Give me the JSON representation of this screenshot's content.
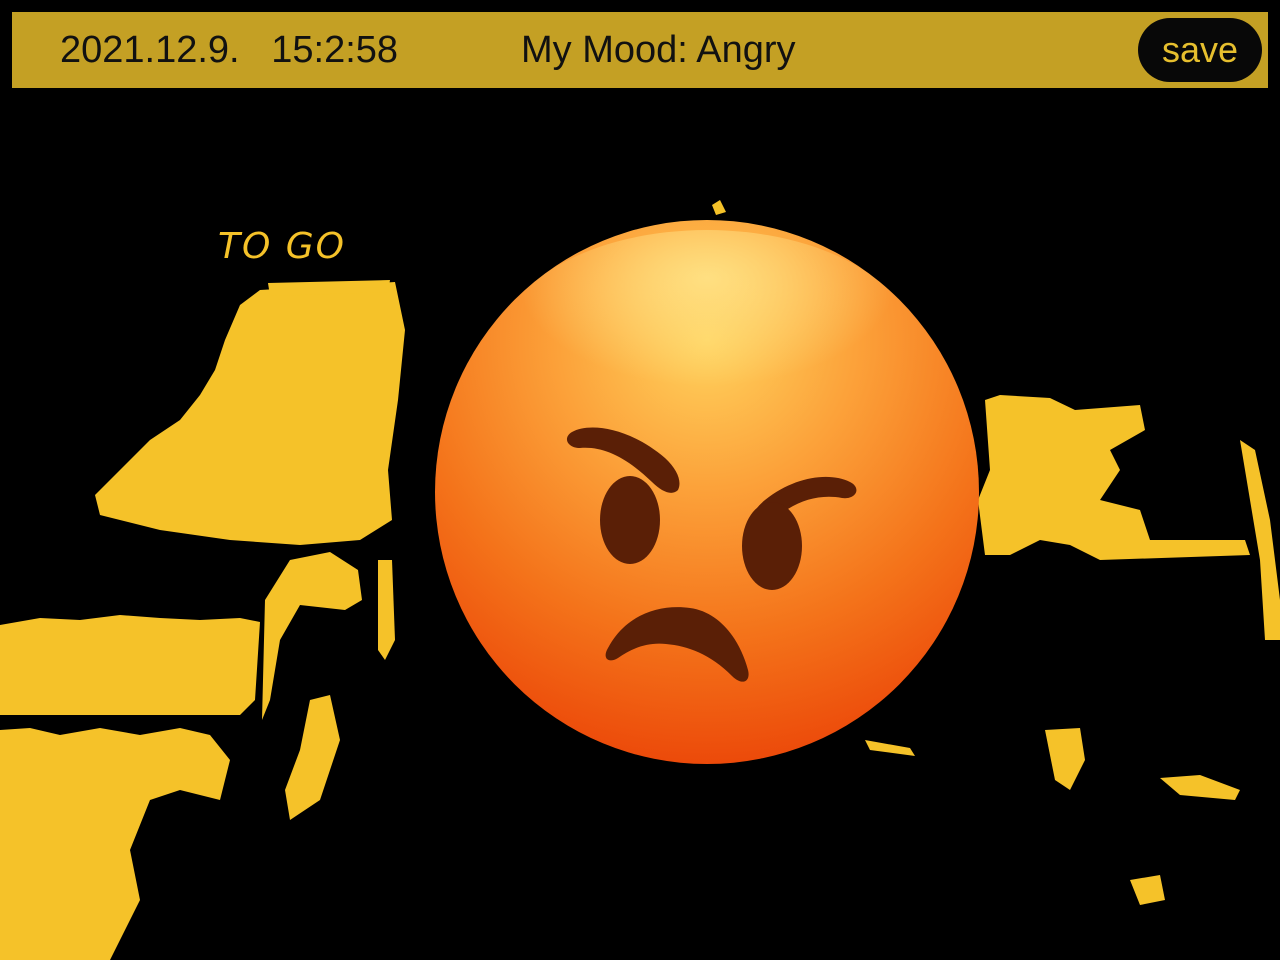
{
  "top_bar": {
    "datetime": "2021.12.9.   15:2:58",
    "mood_text": "My Mood: Angry",
    "save_label": "save"
  },
  "camera_feed": {
    "sign_text": "TO GO",
    "filter_color": "#f5c229",
    "background_color": "#000000"
  },
  "mood_emoji": {
    "icon": "angry-face-icon",
    "mood": "Angry",
    "face_color_top": "#ffd35e",
    "face_color_bottom": "#ec4a0a",
    "feature_color": "#5a1f06"
  },
  "colors": {
    "bar_background": "#c4a024",
    "bar_text": "#111111",
    "save_button_background": "#080808",
    "save_button_text": "#e6bf2e"
  }
}
